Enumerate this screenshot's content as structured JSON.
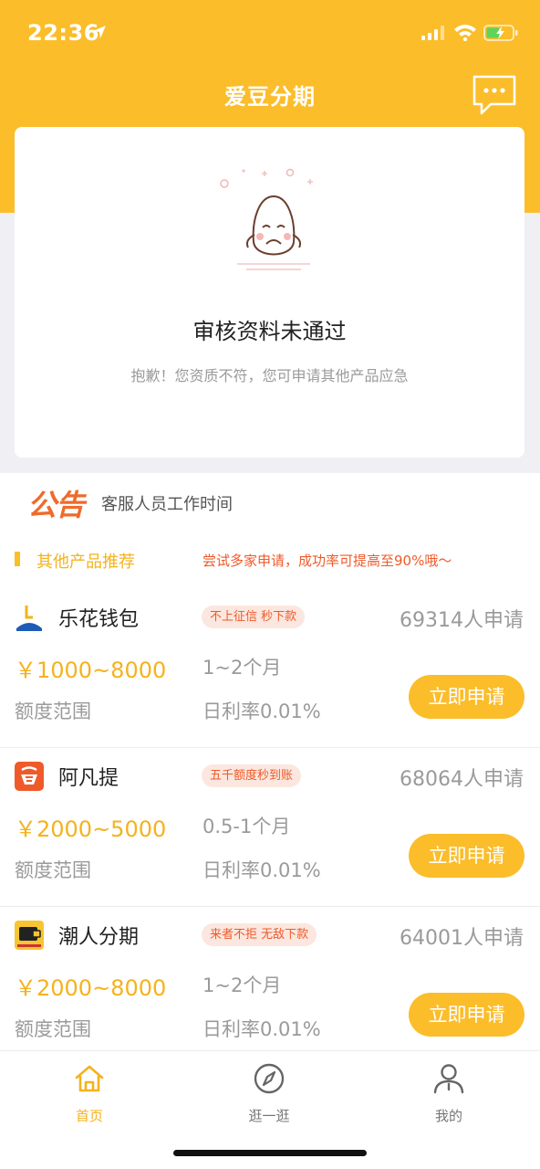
{
  "status_bar": {
    "time": "22:36"
  },
  "header": {
    "title": "爱豆分期"
  },
  "review_card": {
    "title": "审核资料未通过",
    "description": "抱歉！您资质不符，您可申请其他产品应急"
  },
  "notice": {
    "badge": "公告",
    "text": "客服人员工作时间"
  },
  "section": {
    "title": "其他产品推荐",
    "tip": "尝试多家申请，成功率可提高至90%哦～"
  },
  "products": [
    {
      "name": "乐花钱包",
      "tag": "不上征信 秒下款",
      "count": "69314人申请",
      "range": "￥1000~8000",
      "term": "1~2个月",
      "range_label": "额度范围",
      "rate": "日利率0.01%",
      "apply_label": "立即申请"
    },
    {
      "name": "阿凡提",
      "tag": "五千额度秒到账",
      "count": "68064人申请",
      "range": "￥2000~5000",
      "term": "0.5-1个月",
      "range_label": "额度范围",
      "rate": "日利率0.01%",
      "apply_label": "立即申请"
    },
    {
      "name": "潮人分期",
      "tag": "来者不拒 无敌下款",
      "count": "64001人申请",
      "range": "￥2000~8000",
      "term": "1~2个月",
      "range_label": "额度范围",
      "rate": "日利率0.01%",
      "apply_label": "立即申请"
    }
  ],
  "tabbar": [
    {
      "label": "首页",
      "icon": "home-icon",
      "active": true
    },
    {
      "label": "逛一逛",
      "icon": "compass-icon",
      "active": false
    },
    {
      "label": "我的",
      "icon": "user-icon",
      "active": false
    }
  ],
  "colors": {
    "primary": "#fbbd2a",
    "accent_text": "#f5b21d",
    "warning": "#ef5a2a",
    "muted": "#9a9a9a"
  }
}
